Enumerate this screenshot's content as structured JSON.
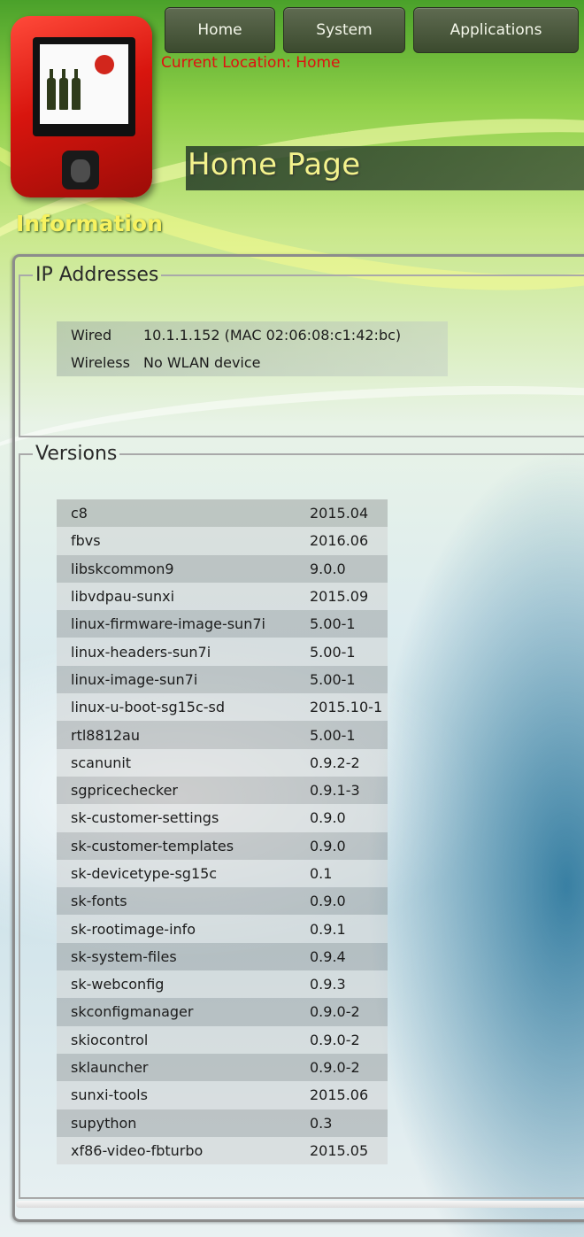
{
  "nav": {
    "home": "Home",
    "system": "System",
    "applications": "Applications"
  },
  "location": {
    "text": "Current Location: Home"
  },
  "page_title": "Home Page",
  "section_title": "Information",
  "ip_addresses": {
    "legend": "IP Addresses",
    "rows": [
      {
        "label": "Wired",
        "value": "10.1.1.152 (MAC 02:06:08:c1:42:bc)"
      },
      {
        "label": "Wireless",
        "value": "No WLAN device"
      }
    ]
  },
  "versions": {
    "legend": "Versions",
    "rows": [
      {
        "name": "c8",
        "version": "2015.04"
      },
      {
        "name": "fbvs",
        "version": "2016.06"
      },
      {
        "name": "libskcommon9",
        "version": "9.0.0"
      },
      {
        "name": "libvdpau-sunxi",
        "version": "2015.09"
      },
      {
        "name": "linux-firmware-image-sun7i",
        "version": "5.00-1"
      },
      {
        "name": "linux-headers-sun7i",
        "version": "5.00-1"
      },
      {
        "name": "linux-image-sun7i",
        "version": "5.00-1"
      },
      {
        "name": "linux-u-boot-sg15c-sd",
        "version": "2015.10-1"
      },
      {
        "name": "rtl8812au",
        "version": "5.00-1"
      },
      {
        "name": "scanunit",
        "version": "0.9.2-2"
      },
      {
        "name": "sgpricechecker",
        "version": "0.9.1-3"
      },
      {
        "name": "sk-customer-settings",
        "version": "0.9.0"
      },
      {
        "name": "sk-customer-templates",
        "version": "0.9.0"
      },
      {
        "name": "sk-devicetype-sg15c",
        "version": "0.1"
      },
      {
        "name": "sk-fonts",
        "version": "0.9.0"
      },
      {
        "name": "sk-rootimage-info",
        "version": "0.9.1"
      },
      {
        "name": "sk-system-files",
        "version": "0.9.4"
      },
      {
        "name": "sk-webconfig",
        "version": "0.9.3"
      },
      {
        "name": "skconfigmanager",
        "version": "0.9.0-2"
      },
      {
        "name": "skiocontrol",
        "version": "0.9.0-2"
      },
      {
        "name": "sklauncher",
        "version": "0.9.0-2"
      },
      {
        "name": "sunxi-tools",
        "version": "2015.06"
      },
      {
        "name": "supython",
        "version": "0.3"
      },
      {
        "name": "xf86-video-fbturbo",
        "version": "2015.05"
      }
    ]
  },
  "icons": {
    "logo": "price-checker-device-logo"
  }
}
